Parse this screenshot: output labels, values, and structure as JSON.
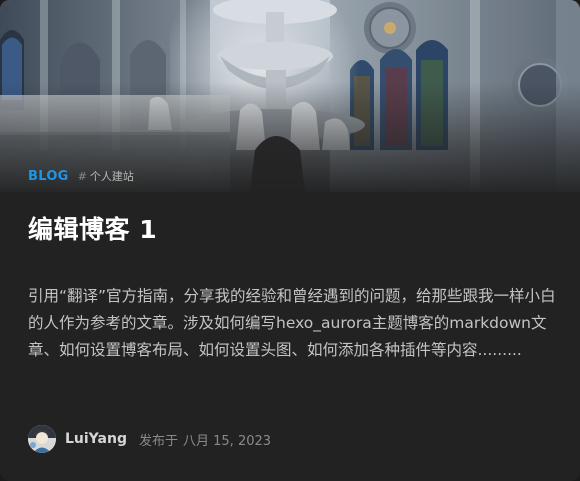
{
  "post": {
    "category": "BLOG",
    "tag_hash": "#",
    "tag": "个人建站",
    "title": "编辑博客 1",
    "excerpt": "引用“翻译”官方指南，分享我的经验和曾经遇到的问题，给那些跟我一样小白的人作为参考的文章。涉及如何编写hexo_aurora主题博客的markdown文章、如何设置博客布局、如何设置头图、如何添加各种插件等内容.........",
    "author": "LuiYang",
    "publish_label": "发布于",
    "publish_date": "八月 15, 2023"
  },
  "colors": {
    "accent": "#1f95e8",
    "card_background": "#222222",
    "title": "#ffffff",
    "body_text": "#c4c4c4",
    "muted_text": "#8a8a8a"
  }
}
